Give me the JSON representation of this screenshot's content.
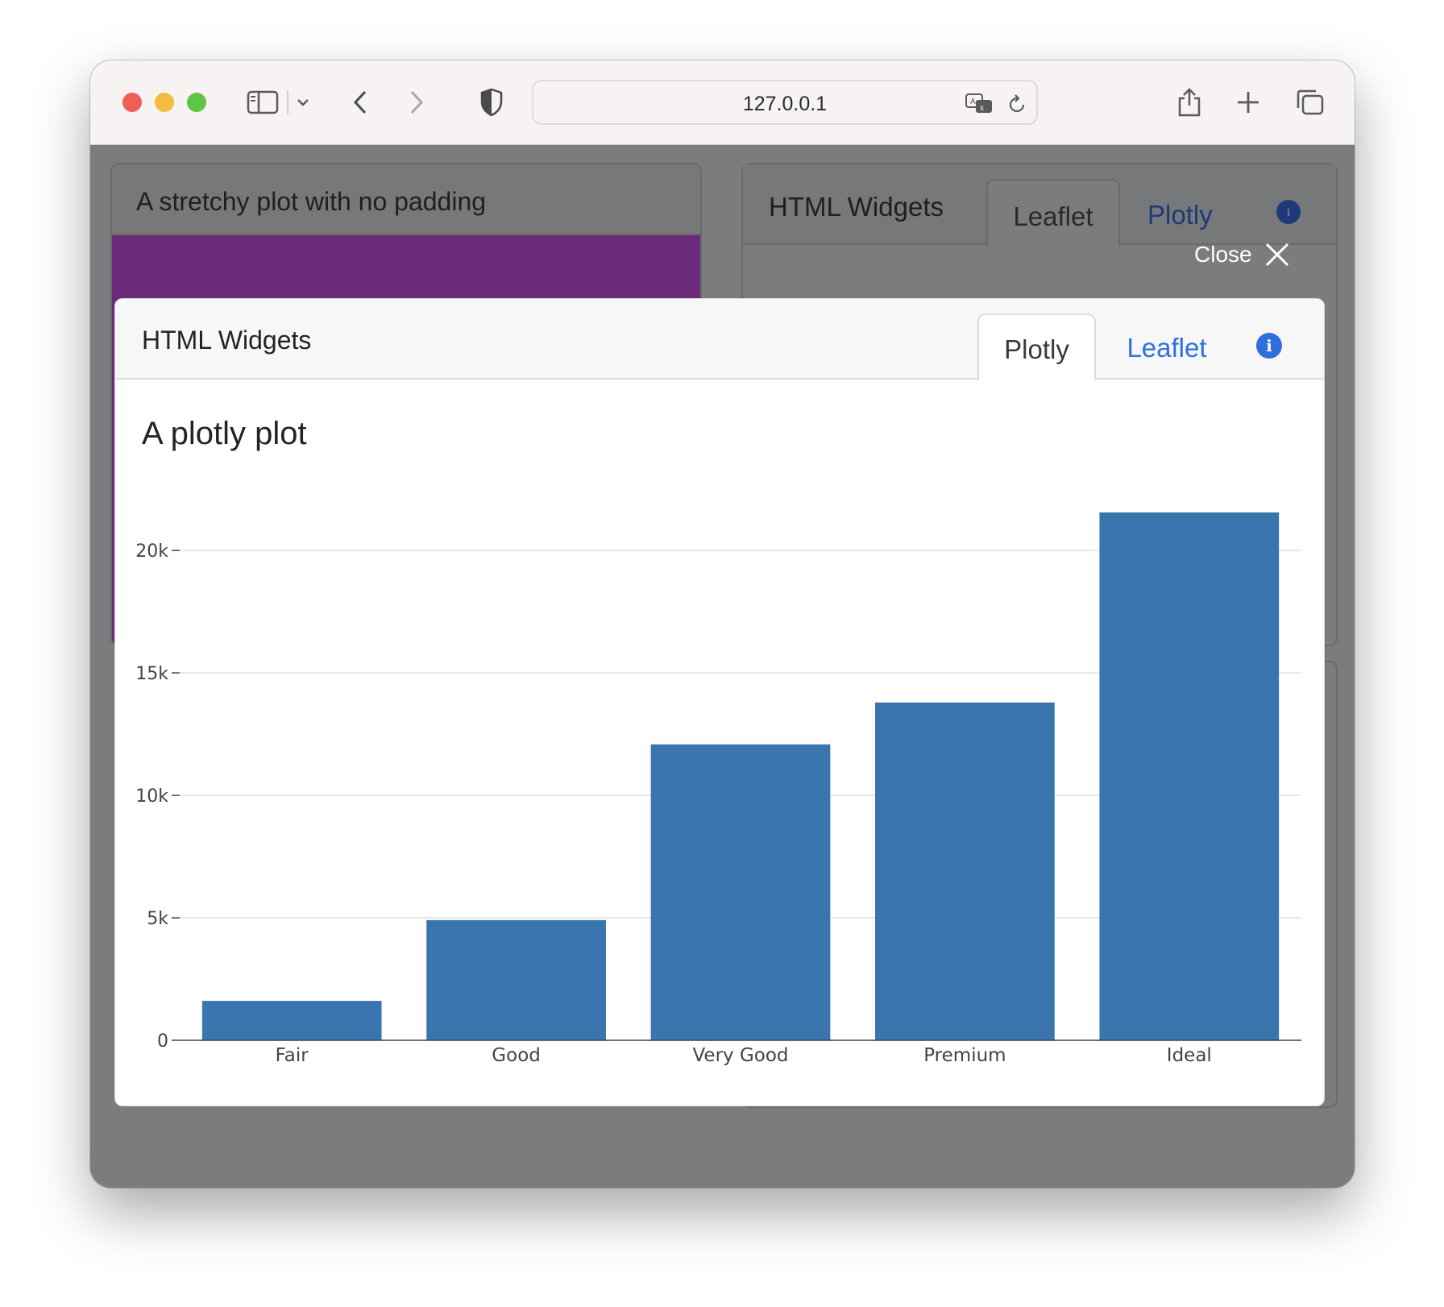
{
  "browser": {
    "url": "127.0.0.1"
  },
  "background_page": {
    "left_card_title": "A stretchy plot with no padding",
    "right_card_title": "HTML Widgets",
    "right_tabs": [
      "Leaflet",
      "Plotly"
    ]
  },
  "overlay": {
    "close_label": "Close"
  },
  "modal": {
    "header_title": "HTML Widgets",
    "tabs": [
      {
        "label": "Plotly",
        "active": true
      },
      {
        "label": "Leaflet",
        "active": false
      }
    ],
    "plot_title": "A plotly plot"
  },
  "colors": {
    "bar": "#3a75af",
    "tab_link": "#2f6fdd",
    "purple_accent": "#6c2a7b"
  },
  "chart_data": {
    "type": "bar",
    "categories": [
      "Fair",
      "Good",
      "Very Good",
      "Premium",
      "Ideal"
    ],
    "values": [
      1610,
      4906,
      12082,
      13791,
      21551
    ],
    "ylim": [
      0,
      22700
    ],
    "yticks": [
      0,
      5000,
      10000,
      15000,
      20000
    ],
    "ytick_labels": [
      "0",
      "5k",
      "10k",
      "15k",
      "20k"
    ],
    "grid": true,
    "legend": "none",
    "xlabel": "",
    "ylabel": ""
  }
}
